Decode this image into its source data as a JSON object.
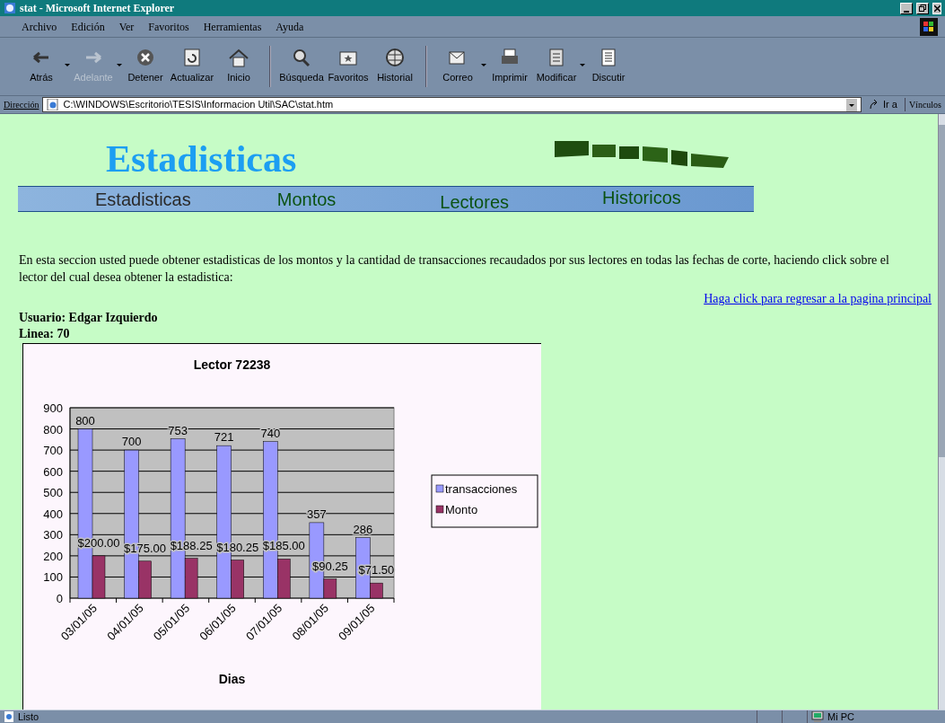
{
  "window": {
    "title": "stat - Microsoft Internet Explorer"
  },
  "menu": [
    "Archivo",
    "Edición",
    "Ver",
    "Favoritos",
    "Herramientas",
    "Ayuda"
  ],
  "toolbar": [
    {
      "label": "Atrás",
      "disabled": false,
      "dropdown": true
    },
    {
      "label": "Adelante",
      "disabled": true,
      "dropdown": true
    },
    {
      "label": "Detener",
      "disabled": false,
      "dropdown": false
    },
    {
      "label": "Actualizar",
      "disabled": false,
      "dropdown": false
    },
    {
      "label": "Inicio",
      "disabled": false,
      "dropdown": false
    },
    {
      "label": "Búsqueda",
      "disabled": false,
      "dropdown": false
    },
    {
      "label": "Favoritos",
      "disabled": false,
      "dropdown": false
    },
    {
      "label": "Historial",
      "disabled": false,
      "dropdown": false
    },
    {
      "label": "Correo",
      "disabled": false,
      "dropdown": true
    },
    {
      "label": "Imprimir",
      "disabled": false,
      "dropdown": false
    },
    {
      "label": "Modificar",
      "disabled": false,
      "dropdown": true
    },
    {
      "label": "Discutir",
      "disabled": false,
      "dropdown": false
    }
  ],
  "address_bar": {
    "label": "Dirección",
    "value": "C:\\WINDOWS\\Escritorio\\TESIS\\Informacion Util\\SAC\\stat.htm",
    "go": "Ir a",
    "links": "Vínculos"
  },
  "page": {
    "heading": "Estadisticas",
    "nav": [
      {
        "label": "Estadisticas",
        "selected": true
      },
      {
        "label": "Montos",
        "selected": false
      },
      {
        "label": "Lectores",
        "selected": false
      },
      {
        "label": "Historicos",
        "selected": false
      }
    ],
    "intro": "En esta seccion usted puede obtener estadisticas de los montos y la cantidad de transacciones recaudados por sus lectores en todas las fechas de corte, haciendo click sobre el lector del cual desea obtener la estadistica:",
    "back_link": "Haga click para regresar a la pagina principal",
    "user": {
      "label": "Usuario:",
      "value": "Edgar Izquierdo"
    },
    "line": {
      "label": "Linea:",
      "value": "70"
    },
    "chart_data": {
      "type": "bar",
      "title": "Lector 72238",
      "xlabel": "Dias",
      "categories": [
        "03/01/05",
        "04/01/05",
        "05/01/05",
        "06/01/05",
        "07/01/05",
        "08/01/05",
        "09/01/05"
      ],
      "series": [
        {
          "name": "transacciones",
          "color": "#9999ff",
          "values": [
            800,
            700,
            753,
            721,
            740,
            357,
            286
          ]
        },
        {
          "name": "Monto",
          "color": "#993366",
          "values": [
            200,
            175,
            188.25,
            180.25,
            185,
            90.25,
            71.5
          ]
        }
      ],
      "grid": true,
      "legend": true,
      "ylim": [
        0,
        900
      ],
      "yticks": [
        0,
        100,
        200,
        300,
        400,
        500,
        600,
        700,
        800,
        900
      ],
      "value_labels": [
        [
          "800",
          "700",
          "753",
          "721",
          "740",
          "357",
          "286"
        ],
        [
          "$200.00",
          "$175.00",
          "$188.25",
          "$180.25",
          "$185.00",
          "$90.25",
          "$71.50"
        ]
      ]
    }
  },
  "status_bar": {
    "text": "Listo",
    "zone": "Mi PC"
  }
}
